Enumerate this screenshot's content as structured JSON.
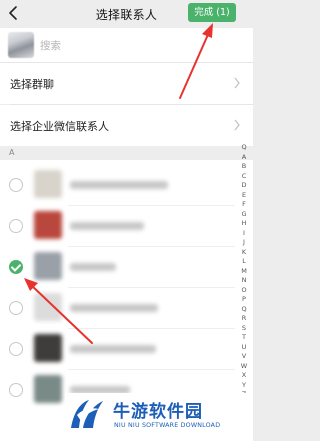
{
  "header": {
    "title": "选择联系人",
    "done_label": "完成 (1)"
  },
  "search": {
    "placeholder": "搜索"
  },
  "menu": [
    {
      "label": "选择群聊"
    },
    {
      "label": "选择企业微信联系人"
    }
  ],
  "section": {
    "letter": "A"
  },
  "contacts": [
    {
      "checked": false,
      "avatar_color": "#d8d4cc"
    },
    {
      "checked": false,
      "avatar_color": "#b9473d"
    },
    {
      "checked": true,
      "avatar_color": "#9aa0a8"
    },
    {
      "checked": false,
      "avatar_color": "#d9d9d9"
    },
    {
      "checked": false,
      "avatar_color": "#3e3d3c"
    },
    {
      "checked": false,
      "avatar_color": "#7a8a86"
    }
  ],
  "index_letters": [
    "Q",
    "A",
    "B",
    "C",
    "D",
    "E",
    "F",
    "G",
    "H",
    "I",
    "J",
    "K",
    "L",
    "M",
    "N",
    "O",
    "P",
    "Q",
    "R",
    "S",
    "T",
    "U",
    "V",
    "W",
    "X",
    "Y",
    "Z",
    "#"
  ],
  "colors": {
    "accent": "#4ab26a",
    "annotation": "#e8322d",
    "watermark": "#1d5fb6"
  },
  "watermark": {
    "cn": "牛游软件园",
    "en": "NIU NIU SOFTWARE DOWNLOAD"
  }
}
